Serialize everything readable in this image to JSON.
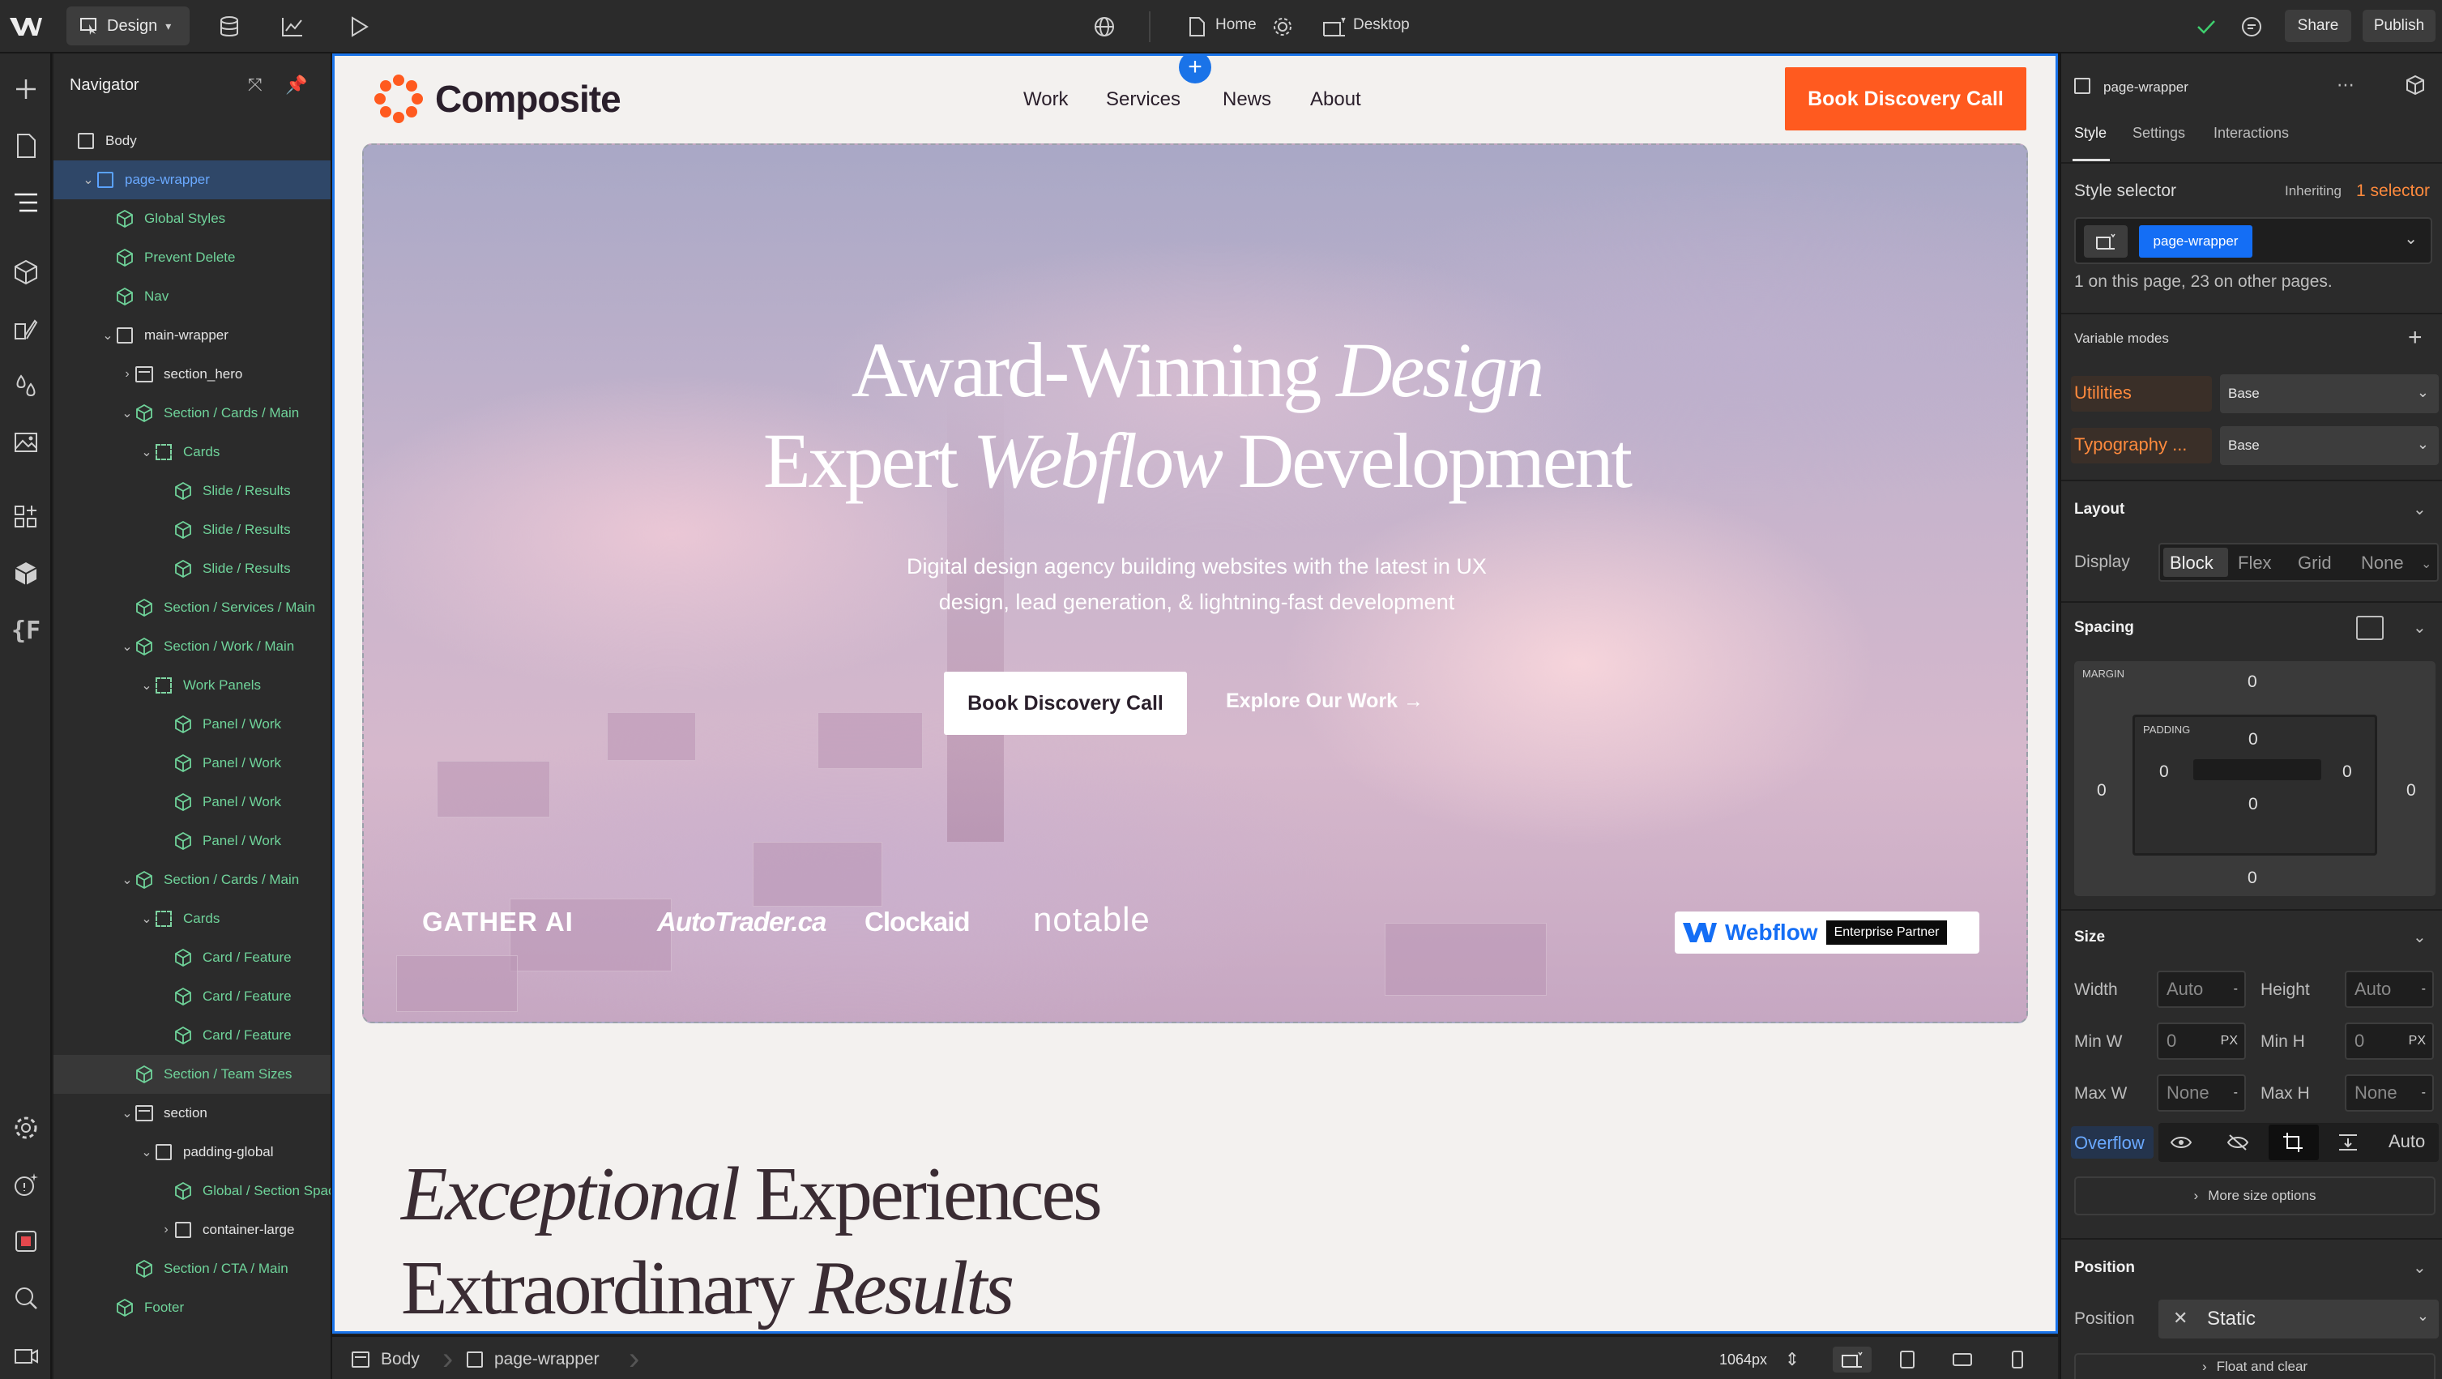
{
  "topbar": {
    "mode_label": "Design",
    "page_label": "Home",
    "breakpoint_label": "Desktop",
    "share_label": "Share",
    "publish_label": "Publish"
  },
  "navigator": {
    "title": "Navigator",
    "items": [
      {
        "label": "Body",
        "indent": 0,
        "icon": "box",
        "caret": "",
        "color": "w"
      },
      {
        "label": "page-wrapper",
        "indent": 1,
        "icon": "box-blue",
        "caret": "v",
        "color": "b",
        "selected": true
      },
      {
        "label": "Global Styles",
        "indent": 2,
        "icon": "component",
        "caret": "",
        "color": "g"
      },
      {
        "label": "Prevent Delete",
        "indent": 2,
        "icon": "component",
        "caret": "",
        "color": "g"
      },
      {
        "label": "Nav",
        "indent": 2,
        "icon": "component",
        "caret": "",
        "color": "g"
      },
      {
        "label": "main-wrapper",
        "indent": 2,
        "icon": "box",
        "caret": "v",
        "color": "w"
      },
      {
        "label": "section_hero",
        "indent": 3,
        "icon": "section",
        "caret": ">",
        "color": "w"
      },
      {
        "label": "Section / Cards / Main",
        "indent": 3,
        "icon": "component",
        "caret": "v",
        "color": "g"
      },
      {
        "label": "Cards",
        "indent": 4,
        "icon": "slot",
        "caret": "v",
        "color": "g"
      },
      {
        "label": "Slide / Results",
        "indent": 5,
        "icon": "component",
        "caret": "",
        "color": "g"
      },
      {
        "label": "Slide / Results",
        "indent": 5,
        "icon": "component",
        "caret": "",
        "color": "g"
      },
      {
        "label": "Slide / Results",
        "indent": 5,
        "icon": "component",
        "caret": "",
        "color": "g"
      },
      {
        "label": "Section / Services / Main",
        "indent": 3,
        "icon": "component",
        "caret": "",
        "color": "g"
      },
      {
        "label": "Section / Work / Main",
        "indent": 3,
        "icon": "component",
        "caret": "v",
        "color": "g"
      },
      {
        "label": "Work Panels",
        "indent": 4,
        "icon": "slot",
        "caret": "v",
        "color": "g"
      },
      {
        "label": "Panel / Work",
        "indent": 5,
        "icon": "component",
        "caret": "",
        "color": "g"
      },
      {
        "label": "Panel / Work",
        "indent": 5,
        "icon": "component",
        "caret": "",
        "color": "g"
      },
      {
        "label": "Panel / Work",
        "indent": 5,
        "icon": "component",
        "caret": "",
        "color": "g"
      },
      {
        "label": "Panel / Work",
        "indent": 5,
        "icon": "component",
        "caret": "",
        "color": "g"
      },
      {
        "label": "Section / Cards / Main",
        "indent": 3,
        "icon": "component",
        "caret": "v",
        "color": "g"
      },
      {
        "label": "Cards",
        "indent": 4,
        "icon": "slot",
        "caret": "v",
        "color": "g"
      },
      {
        "label": "Card / Feature",
        "indent": 5,
        "icon": "component",
        "caret": "",
        "color": "g"
      },
      {
        "label": "Card / Feature",
        "indent": 5,
        "icon": "component",
        "caret": "",
        "color": "g"
      },
      {
        "label": "Card / Feature",
        "indent": 5,
        "icon": "component",
        "caret": "",
        "color": "g"
      },
      {
        "label": "Section / Team Sizes",
        "indent": 3,
        "icon": "component",
        "caret": "",
        "color": "g",
        "hover": true
      },
      {
        "label": "section",
        "indent": 3,
        "icon": "section",
        "caret": "v",
        "color": "w"
      },
      {
        "label": "padding-global",
        "indent": 4,
        "icon": "box",
        "caret": "v",
        "color": "w"
      },
      {
        "label": "Global / Section Spacing",
        "indent": 5,
        "icon": "component",
        "caret": "",
        "color": "g"
      },
      {
        "label": "container-large",
        "indent": 5,
        "icon": "box",
        "caret": ">",
        "color": "w"
      },
      {
        "label": "Section / CTA / Main",
        "indent": 3,
        "icon": "component",
        "caret": "",
        "color": "g"
      },
      {
        "label": "Footer",
        "indent": 2,
        "icon": "component",
        "caret": "",
        "color": "g"
      }
    ]
  },
  "site": {
    "brand": "Composite",
    "nav": [
      "Work",
      "Services",
      "News",
      "About"
    ],
    "cta": "Book Discovery Call",
    "hero_line1_a": "Award-Winning ",
    "hero_line1_b": "Design",
    "hero_line2_a": "Expert ",
    "hero_line2_b": "Webflow",
    "hero_line2_c": " Development",
    "hero_sub": "Digital design agency building websites with the latest in UX design, lead generation, & lightning-fast development",
    "hero_btn_primary": "Book Discovery Call",
    "hero_btn_secondary": "Explore Our Work →",
    "clients": [
      "GATHER AI",
      "AutoTrader.ca",
      "Clockaid",
      "notable"
    ],
    "partner_brand": "Webflow",
    "partner_tag": "Enterprise Partner",
    "sec2_line1_a": "Exceptional",
    "sec2_line1_b": " Experiences",
    "sec2_line2_a": "Extraordinary ",
    "sec2_line2_b": "Results"
  },
  "bottombar": {
    "crumb_body": "Body",
    "crumb_wrapper": "page-wrapper",
    "width_readout": "1064px"
  },
  "panel": {
    "element_name": "page-wrapper",
    "tabs": [
      "Style",
      "Settings",
      "Interactions"
    ],
    "style_selector_label": "Style selector",
    "inheriting_label": "Inheriting",
    "inheriting_count": "1 selector",
    "selector_chip": "page-wrapper",
    "selector_usage": "1 on this page, 23 on other pages.",
    "variable_modes_label": "Variable modes",
    "var_modes": [
      {
        "name": "Utilities",
        "value": "Base"
      },
      {
        "name": "Typography ...",
        "value": "Base"
      }
    ],
    "layout_label": "Layout",
    "display_label": "Display",
    "display_options": [
      "Block",
      "Flex",
      "Grid",
      "None"
    ],
    "spacing_label": "Spacing",
    "margin_label": "MARGIN",
    "padding_label": "PADDING",
    "margin": {
      "top": "0",
      "right": "0",
      "bottom": "0",
      "left": "0"
    },
    "padding": {
      "top": "0",
      "right": "0",
      "bottom": "0",
      "left": "0"
    },
    "size_label": "Size",
    "width_label": "Width",
    "width_val": "Auto",
    "height_label": "Height",
    "height_val": "Auto",
    "minw_label": "Min W",
    "minw_val": "0",
    "minw_unit": "PX",
    "minh_label": "Min H",
    "minh_val": "0",
    "minh_unit": "PX",
    "maxw_label": "Max W",
    "maxw_val": "None",
    "maxh_label": "Max H",
    "maxh_val": "None",
    "overflow_label": "Overflow",
    "overflow_auto": "Auto",
    "more_size": "More size options",
    "position_section": "Position",
    "position_label": "Position",
    "position_value": "Static",
    "float_clear": "Float and clear",
    "dash": "-"
  }
}
